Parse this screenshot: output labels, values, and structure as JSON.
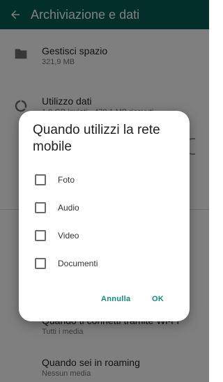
{
  "appbar": {
    "title": "Archiviazione e dati"
  },
  "settings": {
    "manage_storage": {
      "title": "Gestisci spazio",
      "subtitle": "321,9 MB"
    },
    "data_usage": {
      "title": "Utilizzo dati",
      "subtitle": "1,0 GB inviati · 478,1 MB ricevuti"
    },
    "wifi": {
      "title": "Quando ti connetti tramite Wi-Fi",
      "subtitle": "Tutti i media"
    },
    "roaming": {
      "title": "Quando sei in roaming",
      "subtitle": "Nessun media"
    }
  },
  "dialog": {
    "title": "Quando utilizzi la rete mobile",
    "options": [
      {
        "label": "Foto",
        "checked": false
      },
      {
        "label": "Audio",
        "checked": false
      },
      {
        "label": "Video",
        "checked": false
      },
      {
        "label": "Documenti",
        "checked": false
      }
    ],
    "cancel_label": "Annulla",
    "ok_label": "OK"
  },
  "colors": {
    "primary": "#075e54",
    "accent": "#128c7e"
  }
}
